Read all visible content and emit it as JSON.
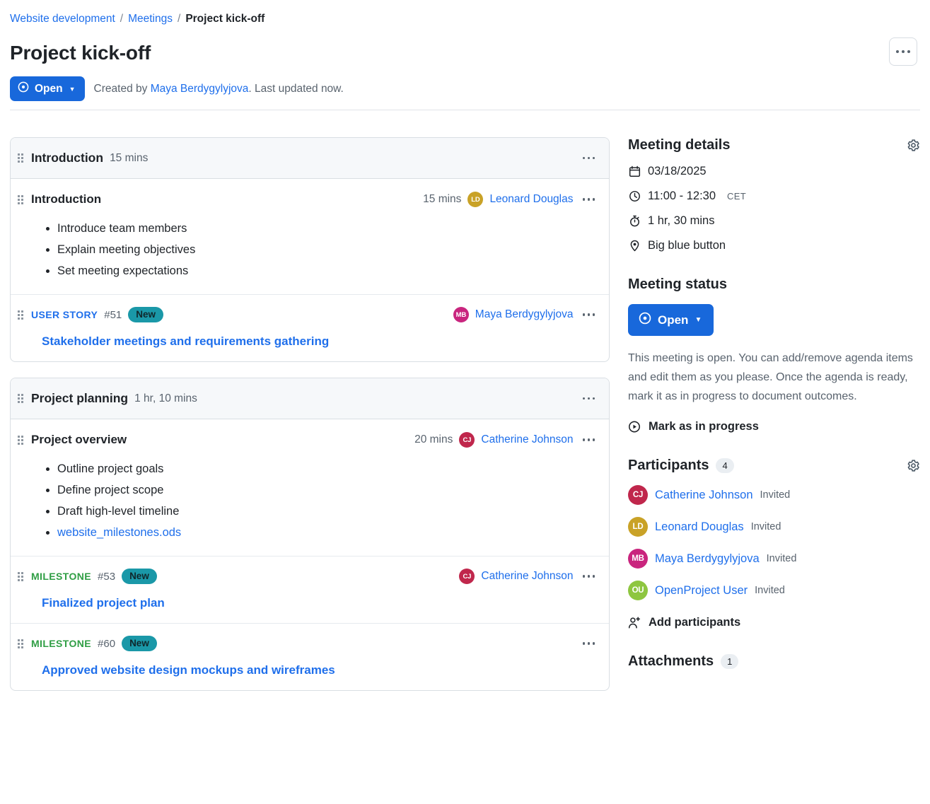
{
  "breadcrumb": {
    "project": "Website development",
    "section": "Meetings",
    "current": "Project kick-off",
    "separator": "/"
  },
  "header": {
    "title": "Project kick-off",
    "status_label": "Open",
    "created_prefix": "Created by",
    "created_by": "Maya Berdygylyjova",
    "created_suffix": ". Last updated now."
  },
  "agenda": {
    "sections": [
      {
        "title": "Introduction",
        "duration": "15 mins",
        "items": [
          {
            "kind": "agenda",
            "title": "Introduction",
            "duration": "15 mins",
            "presenter": "Leonard Douglas",
            "presenter_initials": "LD",
            "presenter_color": "#c9a227",
            "bullets": [
              {
                "text": "Introduce team members",
                "link": false
              },
              {
                "text": "Explain meeting objectives",
                "link": false
              },
              {
                "text": "Set meeting expectations",
                "link": false
              }
            ]
          },
          {
            "kind": "work_package",
            "type": "USER STORY",
            "type_class": "user-story",
            "id": "#51",
            "badge": "New",
            "presenter": "Maya Berdygylyjova",
            "presenter_initials": "MB",
            "presenter_color": "#c9257e",
            "subject": "Stakeholder meetings and requirements gathering"
          }
        ]
      },
      {
        "title": "Project planning",
        "duration": "1 hr, 10 mins",
        "items": [
          {
            "kind": "agenda",
            "title": "Project overview",
            "duration": "20 mins",
            "presenter": "Catherine Johnson",
            "presenter_initials": "CJ",
            "presenter_color": "#c0274c",
            "bullets": [
              {
                "text": "Outline project goals",
                "link": false
              },
              {
                "text": "Define project scope",
                "link": false
              },
              {
                "text": "Draft high-level timeline",
                "link": false
              },
              {
                "text": "website_milestones.ods",
                "link": true
              }
            ]
          },
          {
            "kind": "work_package",
            "type": "MILESTONE",
            "type_class": "milestone",
            "id": "#53",
            "badge": "New",
            "presenter": "Catherine Johnson",
            "presenter_initials": "CJ",
            "presenter_color": "#c0274c",
            "subject": "Finalized project plan"
          },
          {
            "kind": "work_package",
            "type": "MILESTONE",
            "type_class": "milestone",
            "id": "#60",
            "badge": "New",
            "presenter": "",
            "presenter_initials": "",
            "presenter_color": "",
            "subject": "Approved website design mockups and wireframes"
          }
        ]
      }
    ]
  },
  "sidebar": {
    "details": {
      "title": "Meeting details",
      "date": "03/18/2025",
      "time": "11:00 - 12:30",
      "timezone": "CET",
      "duration": "1 hr, 30 mins",
      "location": "Big blue button"
    },
    "status": {
      "title": "Meeting status",
      "button_label": "Open",
      "description": "This meeting is open. You can add/remove agenda items and edit them as you please. Once the agenda is ready, mark it as in progress to document outcomes.",
      "action_label": "Mark as in progress"
    },
    "participants": {
      "title": "Participants",
      "count": "4",
      "add_label": "Add participants",
      "list": [
        {
          "name": "Catherine Johnson",
          "initials": "CJ",
          "state": "Invited",
          "color": "#c0274c"
        },
        {
          "name": "Leonard Douglas",
          "initials": "LD",
          "state": "Invited",
          "color": "#c9a227"
        },
        {
          "name": "Maya Berdygylyjova",
          "initials": "MB",
          "state": "Invited",
          "color": "#c9257e"
        },
        {
          "name": "OpenProject User",
          "initials": "OU",
          "state": "Invited",
          "color": "#8ec640"
        }
      ]
    },
    "attachments": {
      "title": "Attachments",
      "count": "1"
    }
  },
  "colors": {
    "accent": "#1868db",
    "link": "#1f6feb",
    "badge_new": "#1a98a8",
    "milestone": "#2f9e44"
  }
}
